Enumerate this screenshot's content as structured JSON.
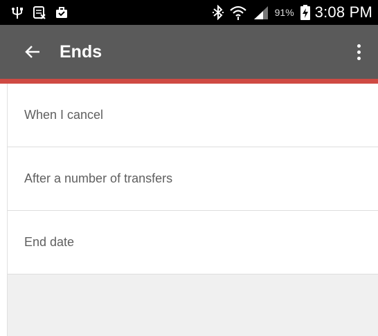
{
  "status_bar": {
    "left_icons": [
      "usb-icon",
      "screenshot-icon",
      "briefcase-icon"
    ],
    "right_icons": [
      "bluetooth-icon",
      "wifi-icon",
      "signal-icon"
    ],
    "battery_percent": "91%",
    "battery_icon": "battery-charging-icon",
    "time": "3:08 PM"
  },
  "app_bar": {
    "title": "Ends",
    "back_icon": "arrow-left-icon",
    "overflow_icon": "more-vert-icon",
    "background_color": "#5a5a5a",
    "accent_color": "#cf4a43"
  },
  "options": [
    {
      "label": "When I cancel"
    },
    {
      "label": "After a number of transfers"
    },
    {
      "label": "End date"
    }
  ]
}
